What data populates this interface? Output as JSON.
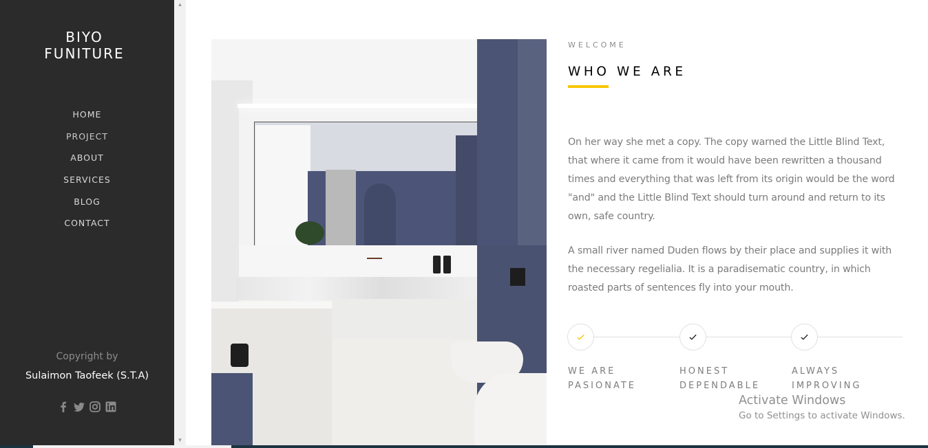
{
  "sidebar": {
    "logo_line1": "BIYO",
    "logo_line2": "FUNITURE",
    "nav": [
      "HOME",
      "PROJECT",
      "ABOUT",
      "SERVICES",
      "BLOG",
      "CONTACT"
    ],
    "copyright_label": "Copyright by",
    "copyright_name": "Sulaimon Taofeek (S.T.A)",
    "socials": [
      "facebook-icon",
      "twitter-icon",
      "instagram-icon",
      "linkedin-icon"
    ]
  },
  "content": {
    "eyebrow": "WELCOME",
    "heading": "WHO WE ARE",
    "accent_color": "#f7c600",
    "paragraph1": "On her way she met a copy. The copy warned the Little Blind Text, that where it came from it would have been rewritten a thousand times and everything that was left from its origin would be the word \"and\" and the Little Blind Text should turn around and return to its own, safe country.",
    "paragraph2": "A small river named Duden flows by their place and supplies it with the necessary regelialia. It is a paradisematic country, in which roasted parts of sentences fly into your mouth.",
    "steps": [
      {
        "line1": "WE ARE",
        "line2": "PASIONATE",
        "active": true
      },
      {
        "line1": "HONEST",
        "line2": "DEPENDABLE",
        "active": false
      },
      {
        "line1": "ALWAYS",
        "line2": "IMPROVING",
        "active": false
      }
    ]
  },
  "watermark": {
    "title": "Activate Windows",
    "subtitle": "Go to Settings to activate Windows."
  }
}
